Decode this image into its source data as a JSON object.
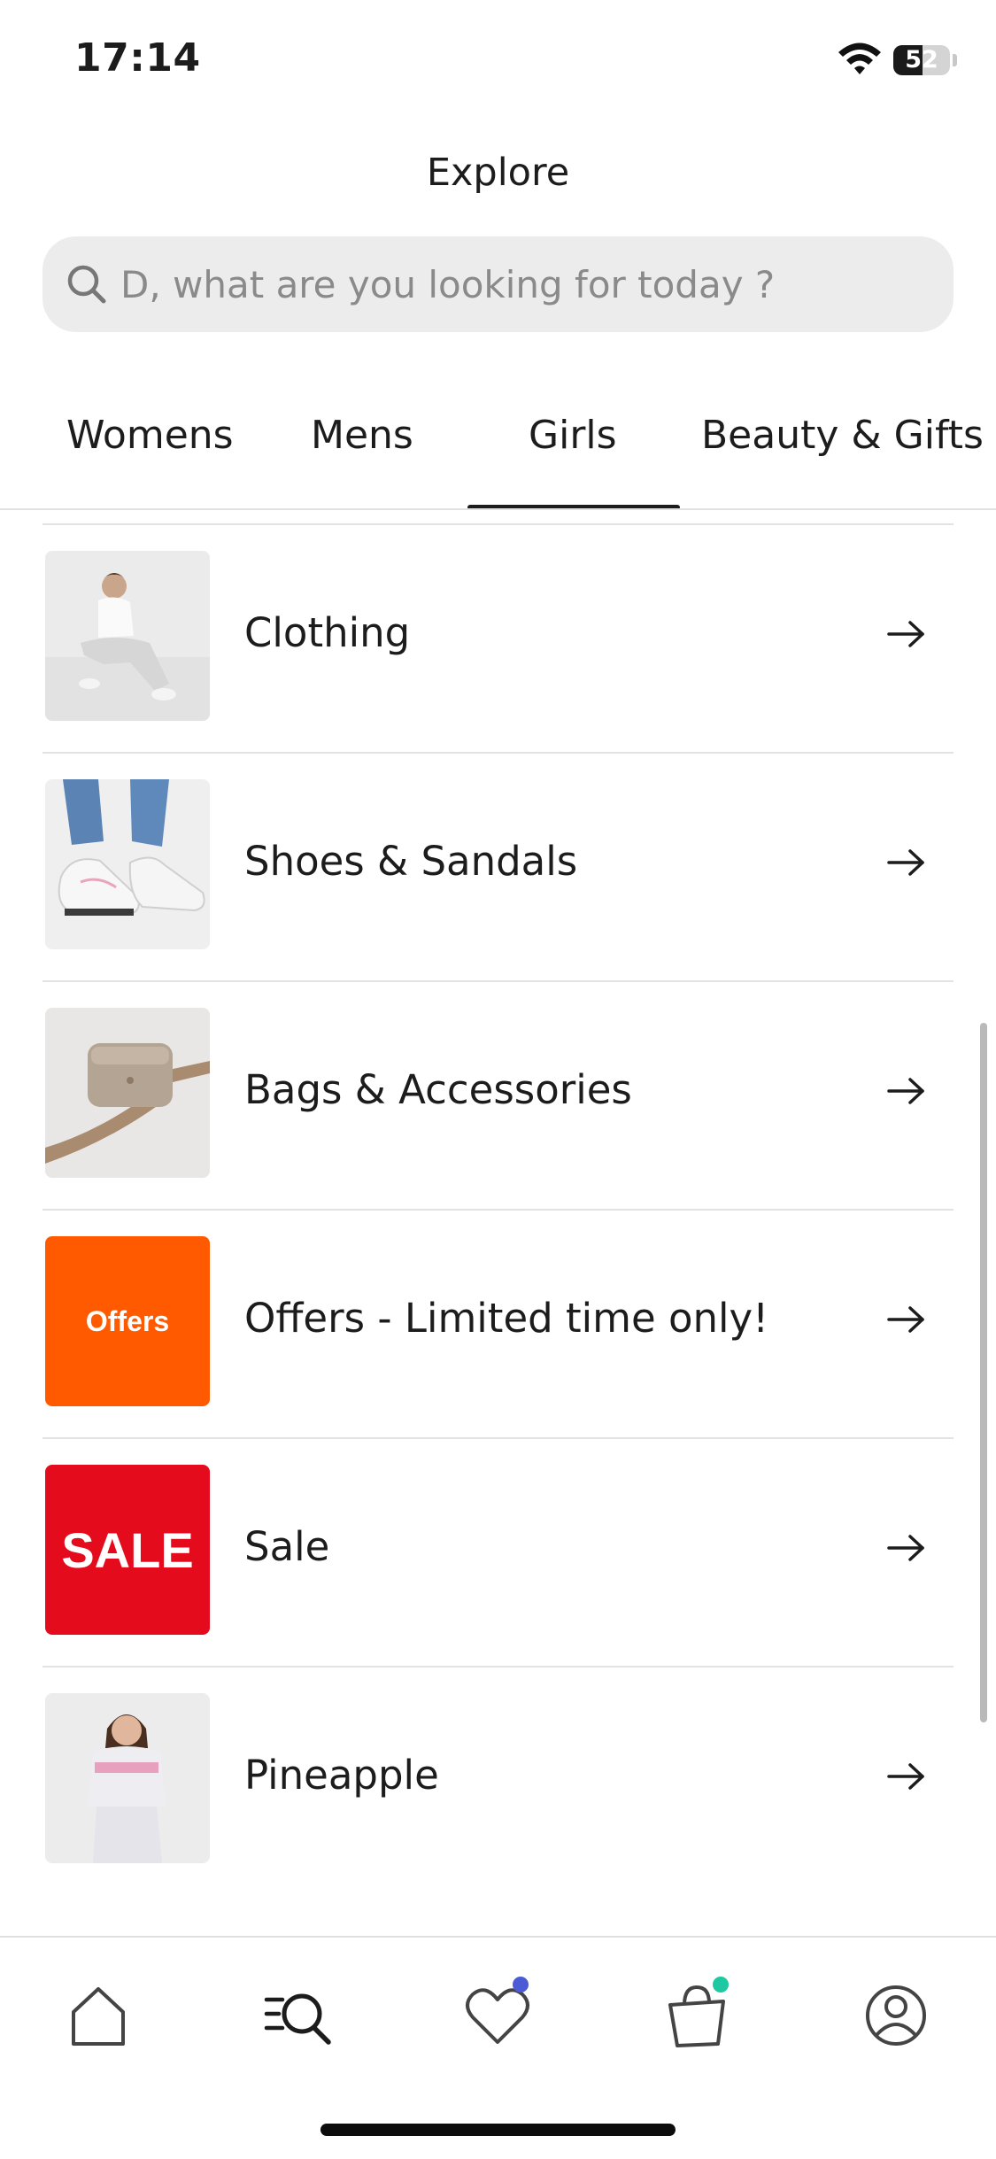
{
  "status_bar": {
    "time": "17:14",
    "battery_level": "52"
  },
  "header": {
    "title": "Explore",
    "search_placeholder": "D, what are you looking for today ?"
  },
  "tabs": [
    {
      "label": "Womens",
      "active": false
    },
    {
      "label": "Mens",
      "active": false
    },
    {
      "label": "Girls",
      "active": true
    },
    {
      "label": "Beauty & Gifts",
      "active": false
    }
  ],
  "categories": [
    {
      "label": "Clothing",
      "thumbnail": "girl-sitting-photo"
    },
    {
      "label": "Shoes & Sandals",
      "thumbnail": "white-sneakers-photo"
    },
    {
      "label": "Bags & Accessories",
      "thumbnail": "crossbody-bag-photo"
    },
    {
      "label": "Offers - Limited time only!",
      "thumbnail": "offers-tile",
      "tile_text": "Offers",
      "tile_color": "#ff5a00"
    },
    {
      "label": "Sale",
      "thumbnail": "sale-tile",
      "tile_text": "SALE",
      "tile_color": "#e30b1c"
    },
    {
      "label": "Pineapple",
      "thumbnail": "pineapple-outfit-photo"
    }
  ],
  "bottom_nav": [
    {
      "name": "home",
      "icon": "home-icon"
    },
    {
      "name": "explore",
      "icon": "search-menu-icon",
      "active": true
    },
    {
      "name": "wishlist",
      "icon": "heart-icon",
      "dot_color": "#4b5bd6"
    },
    {
      "name": "bag",
      "icon": "shopping-bag-icon",
      "dot_color": "#1ec8a0"
    },
    {
      "name": "account",
      "icon": "account-icon"
    }
  ],
  "colors": {
    "text": "#1c1c1c",
    "search_bg": "#ececec",
    "divider": "#e3e3e3"
  }
}
